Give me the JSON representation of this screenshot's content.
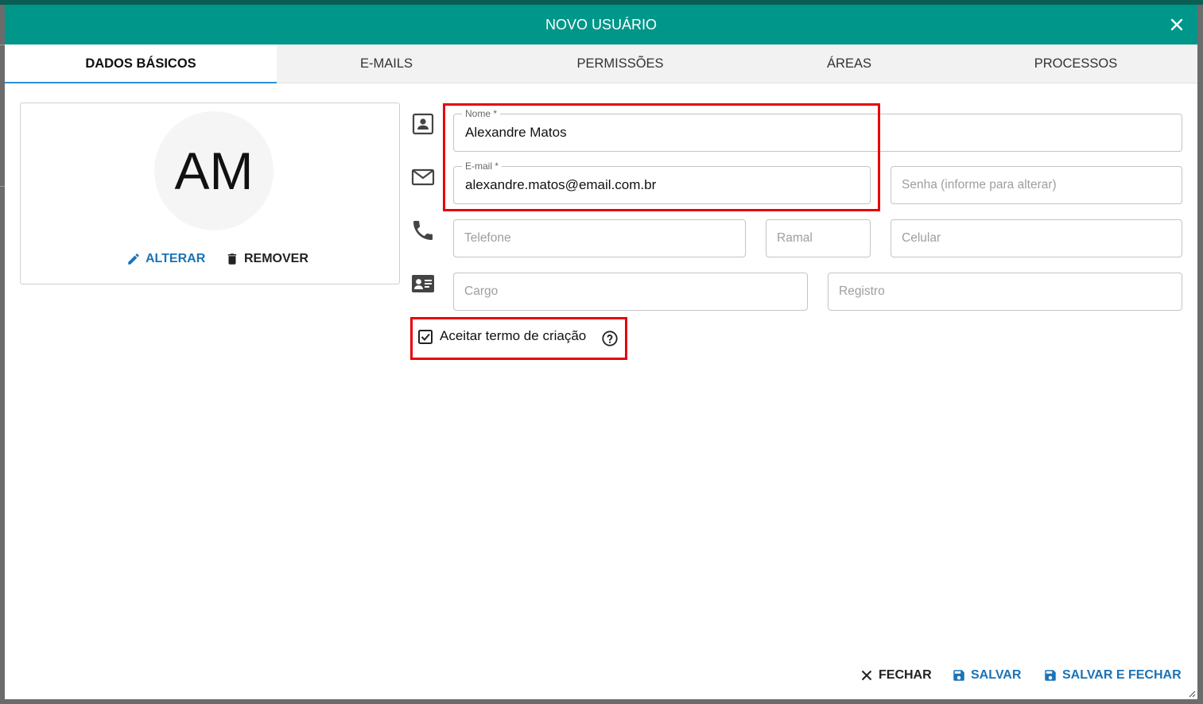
{
  "dialog": {
    "title": "NOVO USUÁRIO",
    "accent_color": "#00968a"
  },
  "tabs": [
    {
      "label": "DADOS BÁSICOS",
      "active": true
    },
    {
      "label": "E-MAILS",
      "active": false
    },
    {
      "label": "PERMISSÕES",
      "active": false
    },
    {
      "label": "ÁREAS",
      "active": false
    },
    {
      "label": "PROCESSOS",
      "active": false
    }
  ],
  "avatar": {
    "initials": "AM",
    "change_label": "ALTERAR",
    "remove_label": "REMOVER"
  },
  "form": {
    "nome": {
      "label": "Nome *",
      "value": "Alexandre Matos"
    },
    "email": {
      "label": "E-mail *",
      "value": "alexandre.matos@email.com.br"
    },
    "senha": {
      "placeholder": "Senha (informe para alterar)"
    },
    "telefone": {
      "placeholder": "Telefone"
    },
    "ramal": {
      "placeholder": "Ramal"
    },
    "celular": {
      "placeholder": "Celular"
    },
    "cargo": {
      "placeholder": "Cargo"
    },
    "registro": {
      "placeholder": "Registro"
    },
    "aceitar_termo": {
      "label": "Aceitar termo de criação",
      "checked": true
    }
  },
  "footer": {
    "close_label": "FECHAR",
    "save_label": "SALVAR",
    "save_close_label": "SALVAR E FECHAR"
  },
  "colors": {
    "link_blue": "#1a73b8",
    "highlight_red": "#e8000b"
  }
}
